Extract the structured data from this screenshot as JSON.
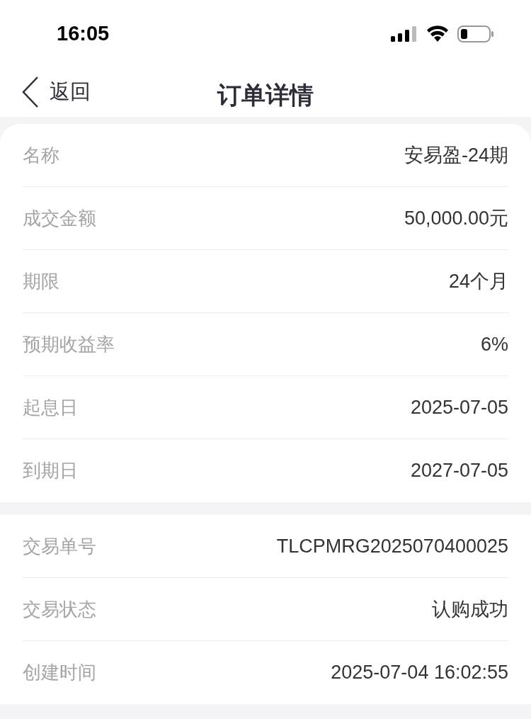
{
  "status_bar": {
    "time": "16:05"
  },
  "nav": {
    "back": "返回",
    "title": "订单详情"
  },
  "sections": [
    {
      "rows": [
        {
          "label": "名称",
          "value": "安易盈-24期"
        },
        {
          "label": "成交金额",
          "value": "50,000.00元"
        },
        {
          "label": "期限",
          "value": "24个月"
        },
        {
          "label": "预期收益率",
          "value": "6%"
        },
        {
          "label": "起息日",
          "value": "2025-07-05"
        },
        {
          "label": "到期日",
          "value": "2027-07-05"
        }
      ]
    },
    {
      "rows": [
        {
          "label": "交易单号",
          "value": "TLCPMRG2025070400025"
        },
        {
          "label": "交易状态",
          "value": "认购成功"
        },
        {
          "label": "创建时间",
          "value": "2025-07-04 16:02:55"
        }
      ]
    }
  ]
}
